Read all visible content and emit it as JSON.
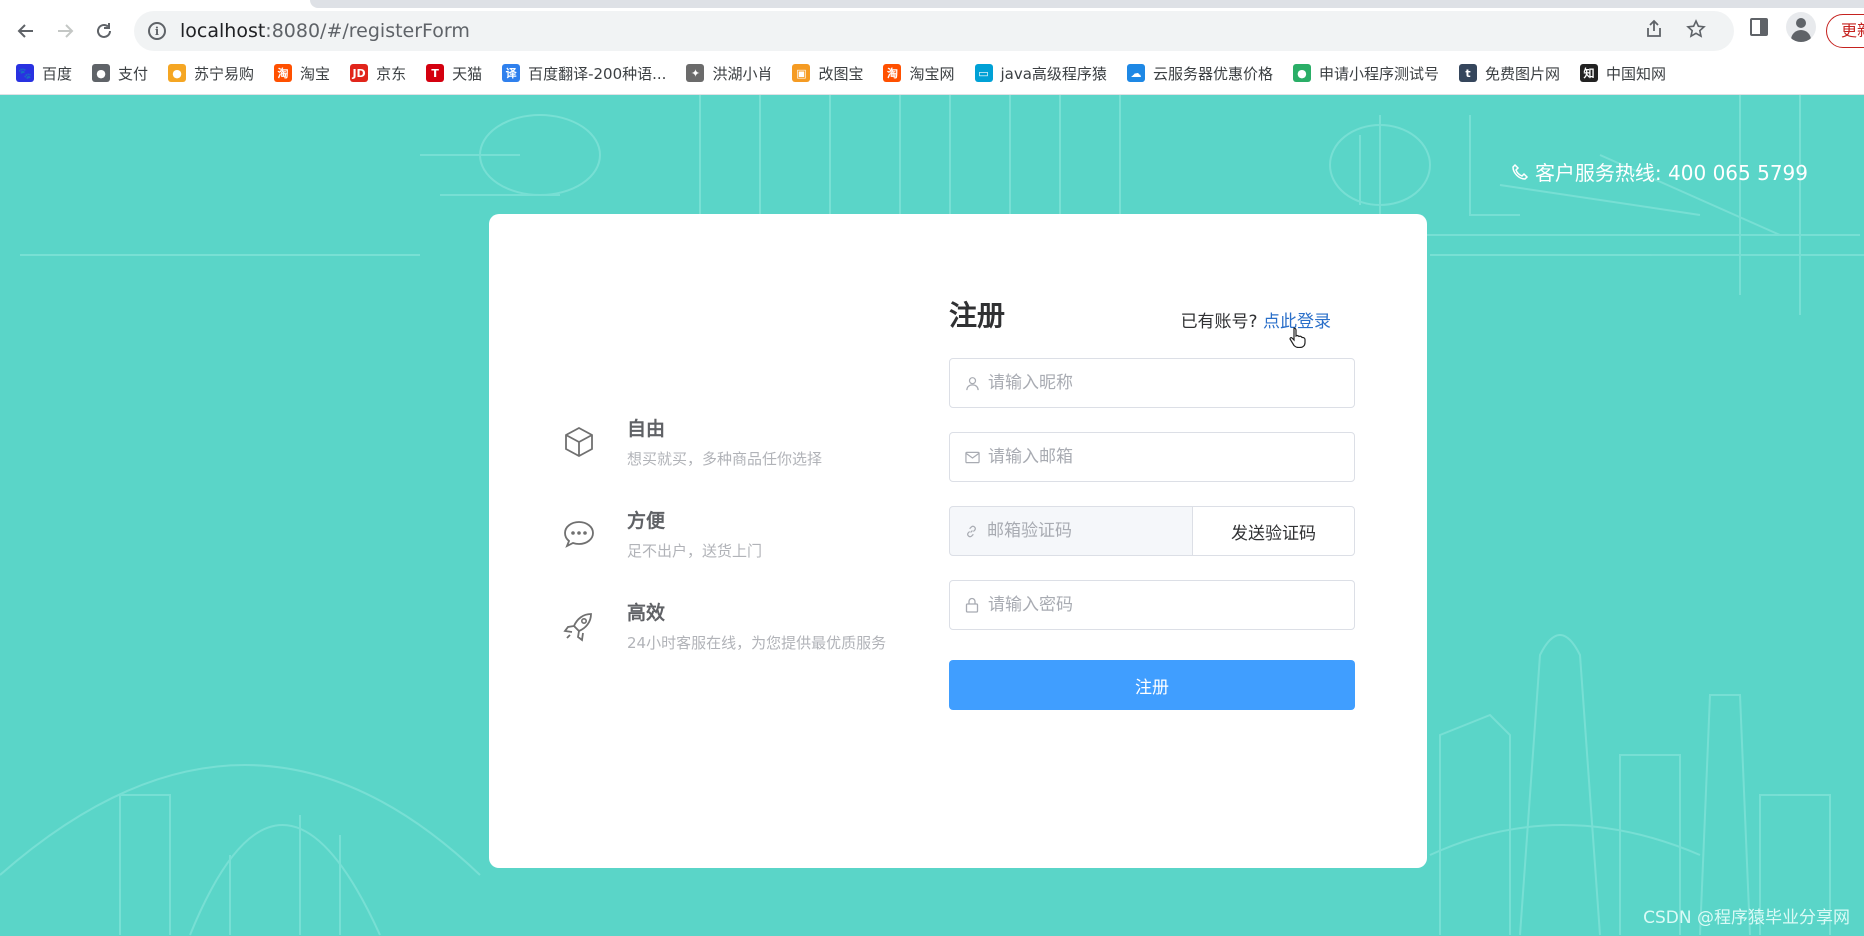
{
  "browser": {
    "url_host": "localhost",
    "url_rest": ":8080/#/registerForm",
    "update_label": "更新"
  },
  "bookmarks": [
    {
      "label": "百度",
      "icon": "baidu-icon",
      "color": "#2932e1"
    },
    {
      "label": "支付",
      "icon": "globe-icon",
      "color": "#5f6368"
    },
    {
      "label": "苏宁易购",
      "icon": "suning-icon",
      "color": "#f5a623"
    },
    {
      "label": "淘宝",
      "icon": "taobao-icon",
      "color": "#ff5000"
    },
    {
      "label": "京东",
      "icon": "jd-icon",
      "color": "#e1251b"
    },
    {
      "label": "天猫",
      "icon": "tmall-icon",
      "color": "#d4000f"
    },
    {
      "label": "百度翻译-200种语...",
      "icon": "translate-icon",
      "color": "#2f80ed"
    },
    {
      "label": "洪湖小肖",
      "icon": "bird-icon",
      "color": "#6b6b6b"
    },
    {
      "label": "改图宝",
      "icon": "gaitubao-icon",
      "color": "#f59b23"
    },
    {
      "label": "淘宝网",
      "icon": "taobao-icon",
      "color": "#ff5000"
    },
    {
      "label": "java高级程序猿",
      "icon": "bilibili-icon",
      "color": "#00a1d6"
    },
    {
      "label": "云服务器优惠价格",
      "icon": "cloud-icon",
      "color": "#1e88e5"
    },
    {
      "label": "申请小程序测试号",
      "icon": "wechat-icon",
      "color": "#2aae67"
    },
    {
      "label": "免费图片网",
      "icon": "tumblr-icon",
      "color": "#35465c"
    },
    {
      "label": "中国知网",
      "icon": "cnki-icon",
      "color": "#222222"
    }
  ],
  "header": {
    "hotline": "客户服务热线: 400 065 5799"
  },
  "features": [
    {
      "title": "自由",
      "desc": "想买就买，多种商品任你选择",
      "icon": "box-icon"
    },
    {
      "title": "方便",
      "desc": "足不出户，送货上门",
      "icon": "chat-icon"
    },
    {
      "title": "高效",
      "desc": "24小时客服在线，为您提供最优质服务",
      "icon": "rocket-icon"
    }
  ],
  "form": {
    "title": "注册",
    "has_account": "已有账号?",
    "login_link": "点此登录",
    "nickname_placeholder": "请输入昵称",
    "email_placeholder": "请输入邮箱",
    "code_placeholder": "邮箱验证码",
    "send_code": "发送验证码",
    "password_placeholder": "请输入密码",
    "submit": "注册"
  },
  "watermark": "CSDN @程序猿毕业分享网",
  "colors": {
    "page_bg": "#5ad5c8",
    "primary": "#409eff",
    "link": "#2a6fc9"
  }
}
